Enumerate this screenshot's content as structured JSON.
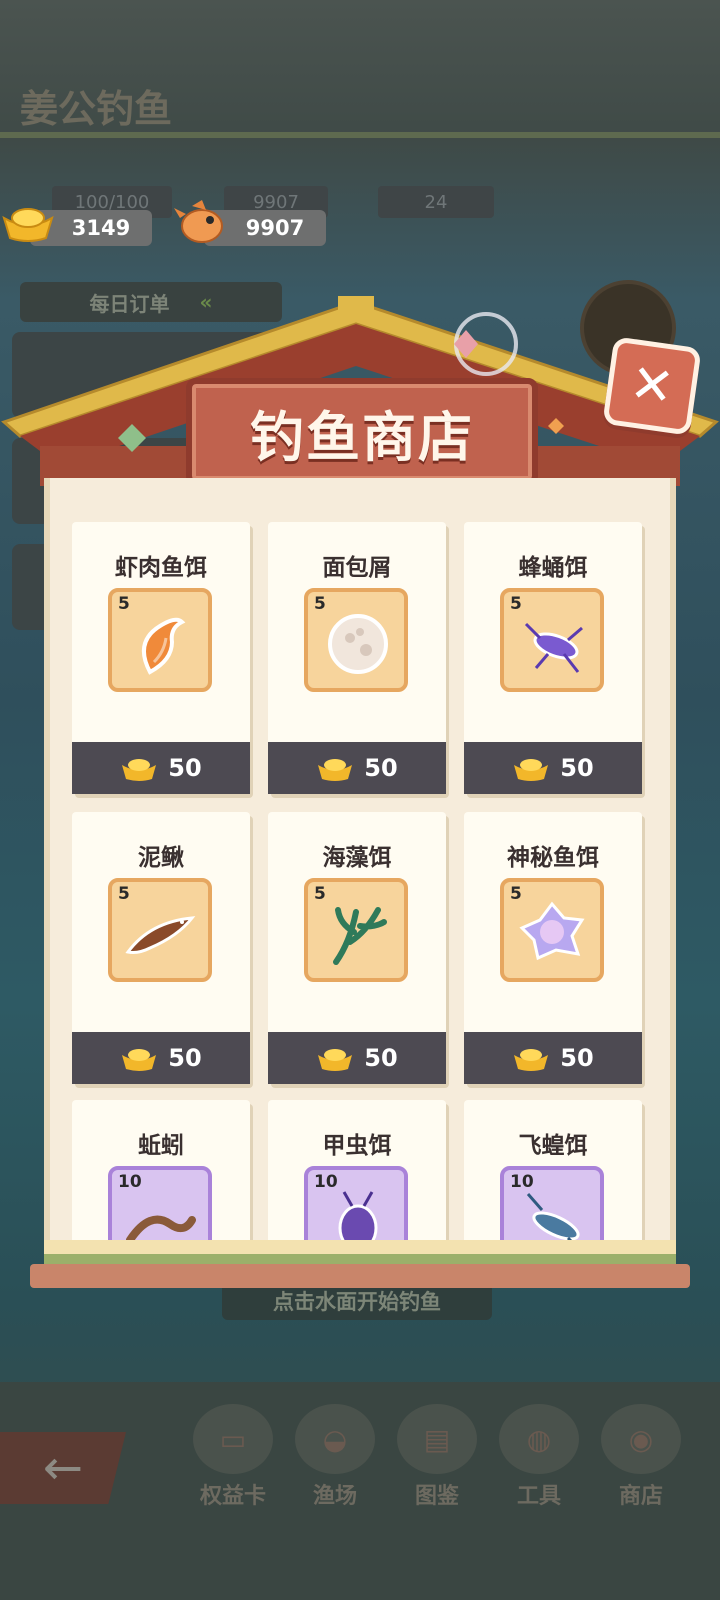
{
  "background": {
    "title": "姜公钓鱼",
    "ghost_stats": [
      "100/100",
      "9907",
      "24"
    ],
    "daily_orders_label": "每日订单",
    "hint_text": "点击水面开始钓鱼",
    "nav_items": [
      {
        "label": "权益卡",
        "icon": "card-icon"
      },
      {
        "label": "渔场",
        "icon": "pond-icon"
      },
      {
        "label": "图鉴",
        "icon": "book-icon"
      },
      {
        "label": "工具",
        "icon": "basket-icon"
      },
      {
        "label": "商店",
        "icon": "shop-icon"
      }
    ]
  },
  "currency": {
    "gold": "3149",
    "fish": "9907"
  },
  "shop": {
    "title": "钓鱼商店",
    "items": [
      {
        "name": "虾肉鱼饵",
        "count": "5",
        "price": "50",
        "tier": "orange",
        "icon": "shrimp-icon"
      },
      {
        "name": "面包屑",
        "count": "5",
        "price": "50",
        "tier": "orange",
        "icon": "bread-crumb-icon"
      },
      {
        "name": "蜂蛹饵",
        "count": "5",
        "price": "50",
        "tier": "orange",
        "icon": "bee-pupa-icon"
      },
      {
        "name": "泥鳅",
        "count": "5",
        "price": "50",
        "tier": "orange",
        "icon": "loach-icon"
      },
      {
        "name": "海藻饵",
        "count": "5",
        "price": "50",
        "tier": "orange",
        "icon": "seaweed-icon"
      },
      {
        "name": "神秘鱼饵",
        "count": "5",
        "price": "50",
        "tier": "orange",
        "icon": "mystery-bait-icon"
      },
      {
        "name": "蚯蚓",
        "count": "10",
        "price": "",
        "tier": "purple",
        "icon": "worm-icon"
      },
      {
        "name": "甲虫饵",
        "count": "10",
        "price": "",
        "tier": "purple",
        "icon": "beetle-icon"
      },
      {
        "name": "飞蝗饵",
        "count": "10",
        "price": "",
        "tier": "purple",
        "icon": "locust-icon"
      }
    ]
  },
  "colors": {
    "sign": "#c0624e",
    "panel": "#f6ecdb",
    "price_bar": "#4d4a52",
    "gold": "#f3c233"
  }
}
